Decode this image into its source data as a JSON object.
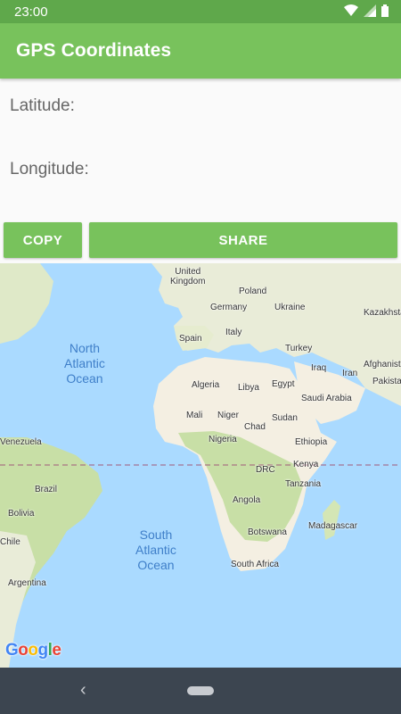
{
  "status": {
    "time": "23:00",
    "icons": [
      "wifi-icon",
      "signal-icon",
      "battery-icon"
    ]
  },
  "appbar": {
    "title": "GPS Coordinates"
  },
  "coordinates": {
    "latitude_label": "Latitude:",
    "longitude_label": "Longitude:"
  },
  "buttons": {
    "copy": "COPY",
    "share": "SHARE"
  },
  "map": {
    "countries": [
      "United\nKingdom",
      "Poland",
      "Germany",
      "Ukraine",
      "Kazakhsta",
      "Spain",
      "Italy",
      "Turkey",
      "Iraq",
      "Iran",
      "Afghanist",
      "Pakista",
      "Algeria",
      "Libya",
      "Egypt",
      "Saudi Arabia",
      "Mali",
      "Niger",
      "Chad",
      "Sudan",
      "Nigeria",
      "Ethiopia",
      "DRC",
      "Kenya",
      "Tanzania",
      "Angola",
      "Botswana",
      "Madagascar",
      "South Africa",
      "Venezuela",
      "Brazil",
      "Bolivia",
      "Chile",
      "Argentina"
    ],
    "oceans": [
      "North\nAtlantic\nOcean",
      "South\nAtlantic\nOcean"
    ],
    "attribution": "Google"
  },
  "navbar": {
    "back": "‹"
  },
  "colors": {
    "appbar": "#78c25c",
    "statusbar": "#5fa84b",
    "water": "#aadaff",
    "land": "#f4efe2",
    "vegetation": "#c8dfa6",
    "navbar": "#3c4550"
  }
}
